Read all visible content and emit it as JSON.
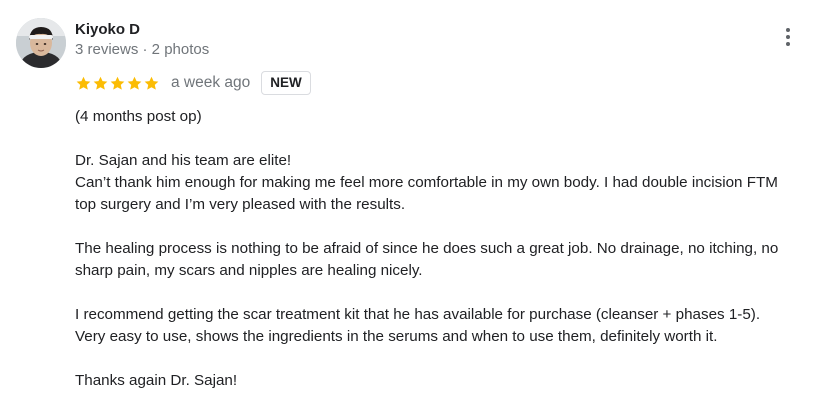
{
  "review": {
    "author": {
      "name": "Kiyoko D",
      "meta": "3 reviews · 2 photos"
    },
    "rating": 5,
    "rating_max": 5,
    "time": "a week ago",
    "badge": "NEW",
    "lines": {
      "l1": "(4 months post op)",
      "l2": "Dr. Sajan and his team are elite!",
      "l3": "Can’t thank him enough for making me feel more comfortable in my own body. I had double incision FTM",
      "l4": "top surgery and I’m very pleased with the results.",
      "l5": "The healing process is nothing to be afraid of since he does such a great job. No drainage, no itching, no",
      "l6": "sharp pain, my scars and nipples are healing nicely.",
      "l7": "I recommend getting the scar treatment kit that he has available for purchase (cleanser + phases 1-5).",
      "l8": "Very easy to use, shows the ingredients in the serums and when to use them, definitely worth it.",
      "l9": "Thanks again Dr. Sajan!"
    }
  },
  "colors": {
    "star": "#fbbc04",
    "muted_text": "#70757a",
    "main_text": "#202124",
    "badge_border": "#dadce0"
  },
  "icons": {
    "more": "more-vert-icon",
    "star": "star-icon"
  }
}
